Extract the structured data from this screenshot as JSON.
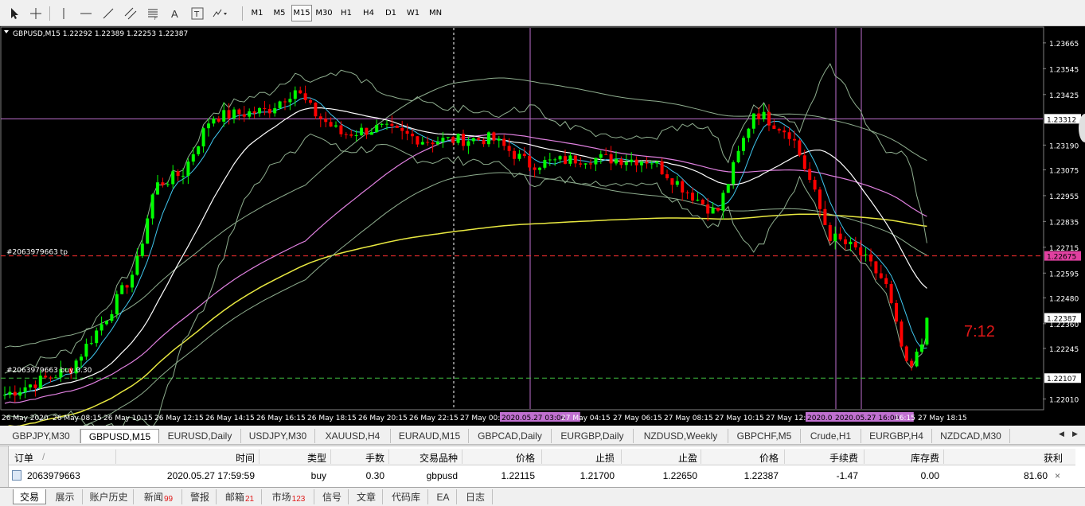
{
  "toolbar": {
    "tools": [
      "cursor-icon",
      "crosshair-icon",
      "vertical-line-icon",
      "horizontal-line-icon",
      "trendline-icon",
      "equidistant-channel-icon",
      "fibonacci-icon",
      "text-icon",
      "text-label-icon",
      "arrows-icon",
      "dropdown-icon"
    ],
    "timeframes": [
      "M1",
      "M5",
      "M15",
      "M30",
      "H1",
      "H4",
      "D1",
      "W1",
      "MN"
    ],
    "active_timeframe": "M15"
  },
  "chart": {
    "title": "GBPUSD,M15  1.22292 1.22389 1.22253 1.22387",
    "background": "#000000",
    "bull_color": "#00ff00",
    "bear_color": "#ff0000",
    "price_labels": [
      "1.23665",
      "1.23545",
      "1.23425",
      "1.23312",
      "1.23190",
      "1.23075",
      "1.22955",
      "1.22835",
      "1.22715",
      "1.22675",
      "1.22595",
      "1.22480",
      "1.22387",
      "1.22360",
      "1.22245",
      "1.22107",
      "1.22010"
    ],
    "time_labels": [
      "26 May 2020",
      "26 May 08:15",
      "26 May 10:15",
      "26 May 12:15",
      "26 May 14:15",
      "26 May 16:15",
      "26 May 18:15",
      "26 May 20:15",
      "26 May 22:15",
      "27 May 00:",
      "2020.05.27 03:00",
      "27 May 04:15",
      "27 May 06:15",
      "27 May 08:15",
      "27 May 10:15",
      "27 May 12:",
      "2020.0",
      "2020.05.27 16:00",
      "16:15",
      "27 May 18:15"
    ],
    "order_line_label": "#2063979663 tp",
    "order_open_label": "#2063979663 buy 0.30",
    "tp_price_tag": "1.22675",
    "open_price_tag": "1.22107",
    "current_price_tag": "1.22387",
    "hline_price_tag": "1.23312",
    "countdown": "7:12"
  },
  "chart_data": {
    "type": "candlestick",
    "symbol": "GBPUSD",
    "timeframe": "M15",
    "y_range": [
      1.2196,
      1.2372
    ],
    "open": 1.22292,
    "high": 1.22389,
    "low": 1.22253,
    "close": 1.22387,
    "tp": 1.22675,
    "entry": 1.22107,
    "hline": 1.23312
  },
  "symbol_tabs": [
    {
      "label": "GBPJPY,M30",
      "active": false
    },
    {
      "label": "GBPUSD,M15",
      "active": true
    },
    {
      "label": "EURUSD,Daily",
      "active": false
    },
    {
      "label": "USDJPY,M30",
      "active": false
    },
    {
      "label": "XAUUSD,H4",
      "active": false
    },
    {
      "label": "EURAUD,M15",
      "active": false
    },
    {
      "label": "GBPCAD,Daily",
      "active": false
    },
    {
      "label": "EURGBP,Daily",
      "active": false
    },
    {
      "label": "NZDUSD,Weekly",
      "active": false
    },
    {
      "label": "GBPCHF,M5",
      "active": false
    },
    {
      "label": "Crude,H1",
      "active": false
    },
    {
      "label": "EURGBP,H4",
      "active": false
    },
    {
      "label": "NZDCAD,M30",
      "active": false
    }
  ],
  "terminal": {
    "headers": [
      "订单",
      "时间",
      "类型",
      "手数",
      "交易品种",
      "价格",
      "止损",
      "止盈",
      "价格",
      "手续费",
      "库存费",
      "获利"
    ],
    "sort_mark": "/",
    "row": [
      "2063979663",
      "2020.05.27 17:59:59",
      "buy",
      "0.30",
      "gbpusd",
      "1.22115",
      "1.21700",
      "1.22650",
      "1.22387",
      "-1.47",
      "0.00",
      "81.60"
    ],
    "close_label": "×"
  },
  "bottom_tabs": [
    {
      "label": "交易",
      "badge": "",
      "active": true
    },
    {
      "label": "展示",
      "badge": "",
      "active": false
    },
    {
      "label": "账户历史",
      "badge": "",
      "active": false
    },
    {
      "label": "新闻",
      "badge": "99",
      "active": false
    },
    {
      "label": "警报",
      "badge": "",
      "active": false
    },
    {
      "label": "邮箱",
      "badge": "21",
      "active": false
    },
    {
      "label": "市场",
      "badge": "123",
      "active": false
    },
    {
      "label": "信号",
      "badge": "",
      "active": false
    },
    {
      "label": "文章",
      "badge": "",
      "active": false
    },
    {
      "label": "代码库",
      "badge": "",
      "active": false
    },
    {
      "label": "EA",
      "badge": "",
      "active": false
    },
    {
      "label": "日志",
      "badge": "",
      "active": false
    }
  ]
}
